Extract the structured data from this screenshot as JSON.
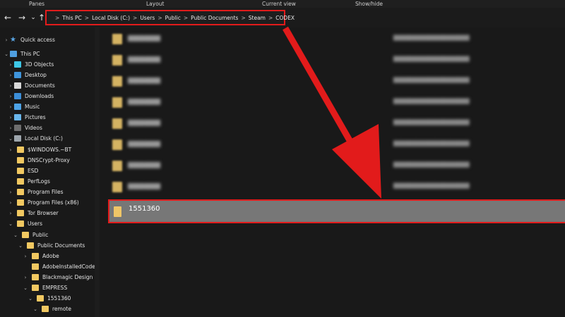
{
  "ribbon": {
    "groups": [
      "Panes",
      "Layout",
      "Current view",
      "Show/hide"
    ]
  },
  "nav": {
    "back_glyph": "←",
    "forward_glyph": "→",
    "recent_glyph": "⌄",
    "up_glyph": "↑"
  },
  "address_bar": {
    "separator": ">",
    "crumbs": [
      "This PC",
      "Local Disk (C:)",
      "Users",
      "Public",
      "Public Documents",
      "Steam",
      "CODEX"
    ]
  },
  "sidebar": {
    "items": [
      {
        "label": "Quick access",
        "icon": "star-icon"
      },
      {
        "label": "This PC",
        "icon": "computer-icon"
      },
      {
        "label": "3D Objects",
        "icon": "3d-objects-icon"
      },
      {
        "label": "Desktop",
        "icon": "desktop-icon"
      },
      {
        "label": "Documents",
        "icon": "documents-icon"
      },
      {
        "label": "Downloads",
        "icon": "downloads-icon"
      },
      {
        "label": "Music",
        "icon": "music-icon"
      },
      {
        "label": "Pictures",
        "icon": "pictures-icon"
      },
      {
        "label": "Videos",
        "icon": "videos-icon"
      },
      {
        "label": "Local Disk (C:)",
        "icon": "disk-icon"
      },
      {
        "label": "$WINDOWS.~BT",
        "icon": "folder-icon"
      },
      {
        "label": "DNSCrypt-Proxy",
        "icon": "folder-icon"
      },
      {
        "label": "ESD",
        "icon": "folder-icon"
      },
      {
        "label": "PerfLogs",
        "icon": "folder-icon"
      },
      {
        "label": "Program Files",
        "icon": "folder-icon"
      },
      {
        "label": "Program Files (x86)",
        "icon": "folder-icon"
      },
      {
        "label": "Tor Browser",
        "icon": "folder-icon"
      },
      {
        "label": "Users",
        "icon": "folder-icon"
      },
      {
        "label": "Public",
        "icon": "folder-icon"
      },
      {
        "label": "Public Documents",
        "icon": "folder-icon"
      },
      {
        "label": "Adobe",
        "icon": "folder-icon"
      },
      {
        "label": "AdobeInstalledCodecs",
        "icon": "folder-icon"
      },
      {
        "label": "Blackmagic Design",
        "icon": "folder-icon"
      },
      {
        "label": "EMPRESS",
        "icon": "folder-icon"
      },
      {
        "label": "1551360",
        "icon": "folder-icon"
      },
      {
        "label": "remote",
        "icon": "folder-icon"
      }
    ]
  },
  "file_list": {
    "selected": {
      "name": "1551360",
      "icon": "folder-icon"
    }
  },
  "colors": {
    "highlight_red": "#e21b1b",
    "selection_gray": "#777777",
    "folder_yellow": "#efc667"
  }
}
